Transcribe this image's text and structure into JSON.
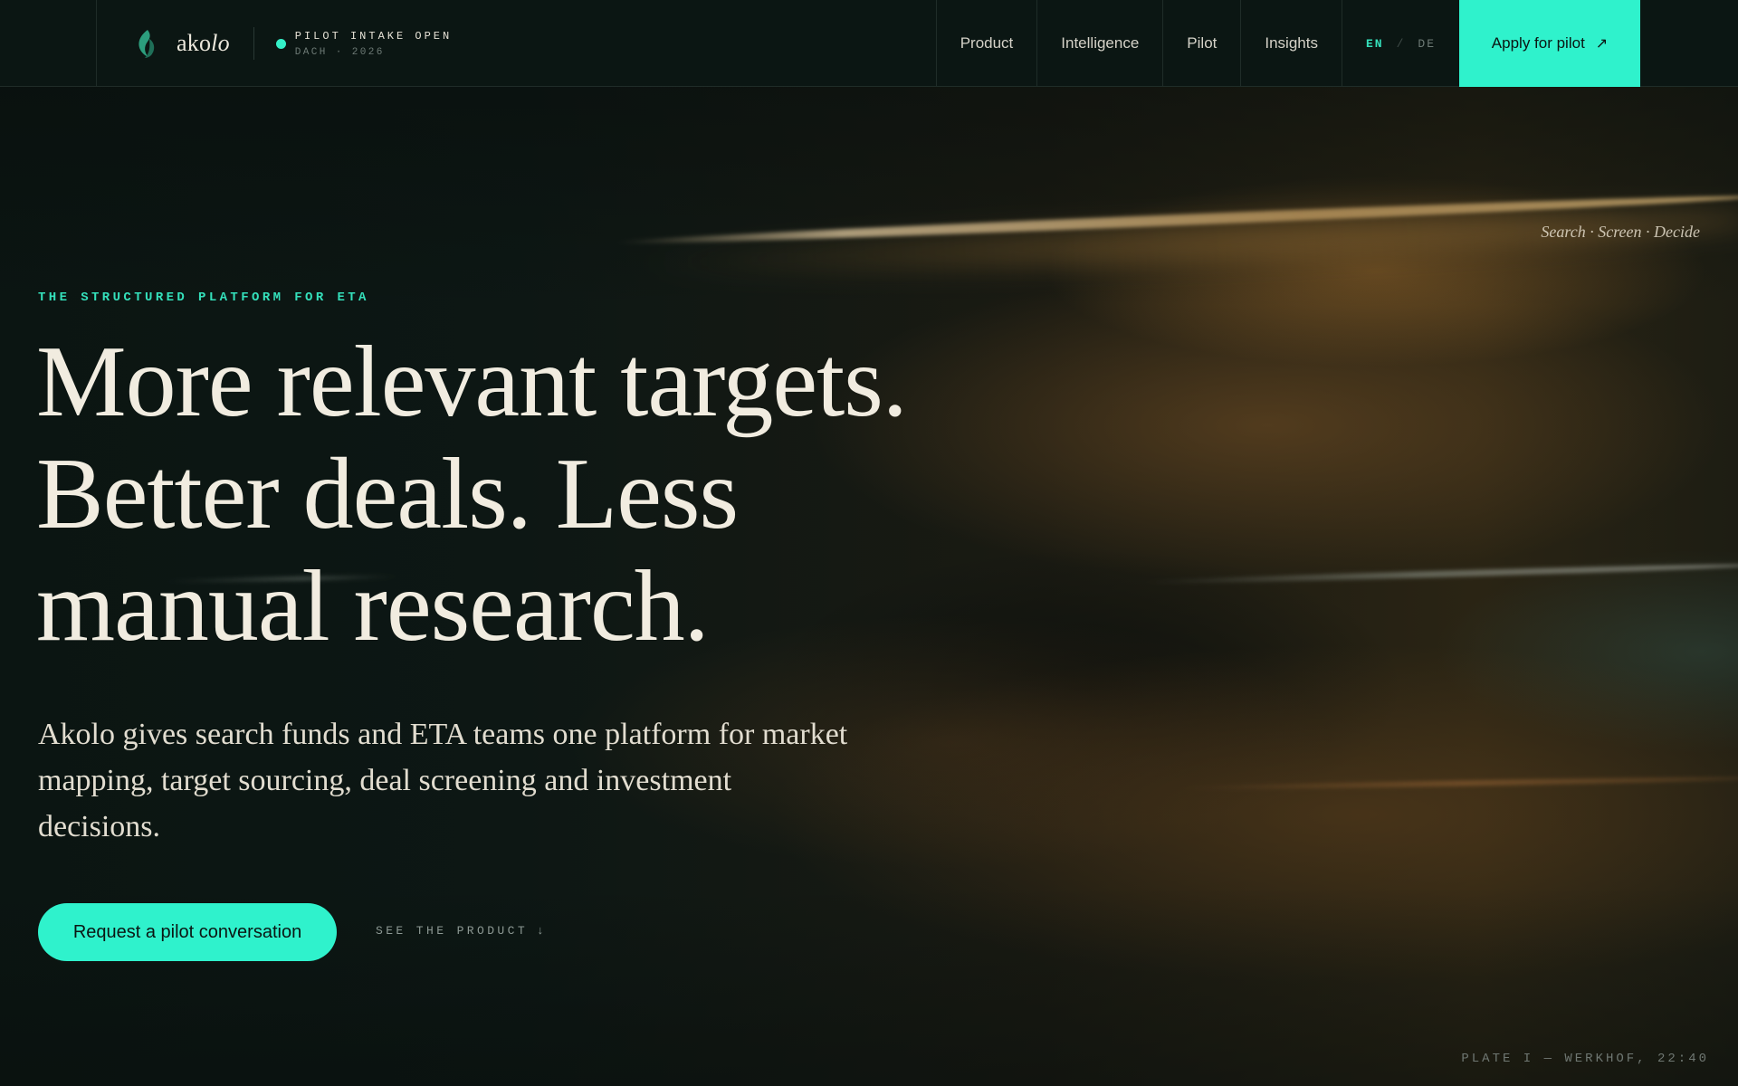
{
  "brand": {
    "name_prefix": "ako",
    "name_suffix": "lo",
    "logo_icon": "flame-leaf-icon"
  },
  "status": {
    "title": "PILOT INTAKE OPEN",
    "subtitle": "DACH · 2026",
    "color": "#34f0c8"
  },
  "nav": {
    "items": [
      {
        "label": "Product"
      },
      {
        "label": "Intelligence"
      },
      {
        "label": "Pilot"
      },
      {
        "label": "Insights"
      }
    ],
    "lang": {
      "active": "EN",
      "separator": "/",
      "inactive": "DE"
    },
    "apply": {
      "label": "Apply for pilot",
      "icon": "arrow-up-right-icon",
      "arrow": "↗"
    }
  },
  "hero": {
    "side_caption": "Search · Screen · Decide",
    "eyebrow": "THE STRUCTURED PLATFORM FOR ETA",
    "headline_lines": [
      "More relevant targets.",
      "Better deals. Less",
      "manual research."
    ],
    "lede": "Akolo gives search funds and ETA teams one platform for market mapping, target sourcing, deal screening and investment decisions.",
    "cta_primary": "Request a pilot conversation",
    "cta_secondary": "SEE THE PRODUCT",
    "cta_secondary_icon": "arrow-down-icon",
    "cta_secondary_arrow": "↓",
    "plate": "PLATE I — WERKHOF, 22:40"
  },
  "colors": {
    "accent": "#2ff2cc",
    "background": "#0b1512",
    "text": "#f1ece0"
  }
}
